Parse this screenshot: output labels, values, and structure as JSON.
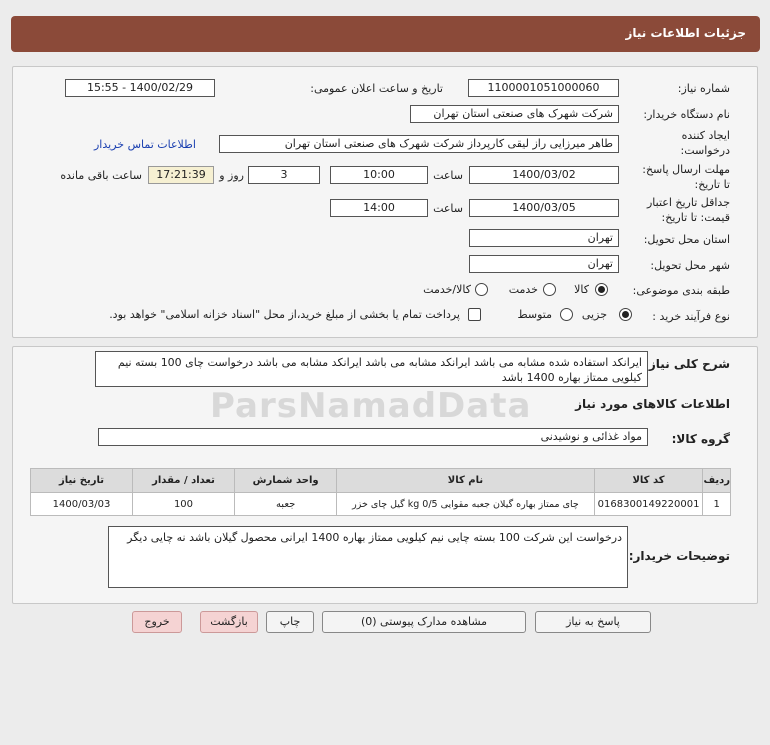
{
  "page": {
    "title": "جزئیات اطلاعات نیاز",
    "watermark": "ParsNamadData"
  },
  "details": {
    "need_number_label": "شماره نیاز:",
    "need_number": "1100001051000060",
    "announce_label": "تاریخ و ساعت اعلان عمومی:",
    "announce_value": "1400/02/29 - 15:55",
    "buyer_org_label": "نام دستگاه خریدار:",
    "buyer_org": "شرکت شهرک های صنعتی استان تهران",
    "creator_label_1": "ایجاد کننده",
    "creator_label_2": "درخواست:",
    "creator": "طاهر  میرزایی راز لیقی کارپرداز شرکت شهرک های صنعتی استان تهران",
    "contact_link": "اطلاعات تماس خریدار",
    "reply_deadline_label_1": "مهلت ارسال پاسخ:",
    "reply_deadline_label_2": "تا تاریخ:",
    "reply_date": "1400/03/02",
    "time_label": "ساعت",
    "reply_time": "10:00",
    "days_value": "3",
    "days_label": "روز و",
    "remaining_time": "17:21:39",
    "remaining_label": "ساعت باقی مانده",
    "validity_label_1": "جداقل تاریخ اعتبار",
    "validity_label_2": "قیمت: تا تاریخ:",
    "validity_date": "1400/03/05",
    "validity_time_label": "ساعت",
    "validity_time": "14:00",
    "province_label": "استان محل تحویل:",
    "province": "تهران",
    "city_label": "شهر محل تحویل:",
    "city": "تهران",
    "category_label": "طبقه بندی موضوعی:",
    "category_options": {
      "goods": "کالا",
      "service": "خدمت",
      "goods_service": "کالا/خدمت"
    },
    "process_label": "نوع فرآیند خرید :",
    "process_options": {
      "partial": "جزیی",
      "medium": "متوسط"
    },
    "payment_note": "پرداخت تمام یا بخشی از مبلغ خرید،از محل \"اسناد خزانه اسلامی\" خواهد بود."
  },
  "description": {
    "label": "شرح کلی نیاز:",
    "text": "ایرانکد استفاده شده مشابه می باشد  ایرانکد مشابه می باشد  ایرانکد مشابه می باشد  درخواست چای 100 بسته نیم کیلویی ممتاز بهاره 1400 باشد"
  },
  "goods_section": {
    "title": "اطلاعات کالاهای مورد نیاز",
    "group_label": "گروه کالا:",
    "group_value": "مواد غذائی و نوشیدنی"
  },
  "table": {
    "headers": [
      "ردیف",
      "کد کالا",
      "نام کالا",
      "واحد شمارش",
      "تعداد / مقدار",
      "تاریخ نیاز"
    ],
    "rows": [
      [
        "1",
        "0168300149220001",
        "چای ممتاز بهاره گیلان جعبه مقوایی kg 0/5 گیل چای خزر",
        "جعبه",
        "100",
        "1400/03/03"
      ]
    ]
  },
  "buyer_notes": {
    "label": "توضیحات خریدار:",
    "text": "درخواست این شرکت 100 بسته چایی نیم کیلویی ممتاز بهاره 1400 ایرانی  محصول گیلان باشد  نه چایی دیگر"
  },
  "buttons": {
    "reply": "پاسخ به نیاز",
    "attachments": "مشاهده مدارک پیوستی (0)",
    "print": "چاپ",
    "back": "بازگشت",
    "exit": "خروج"
  }
}
